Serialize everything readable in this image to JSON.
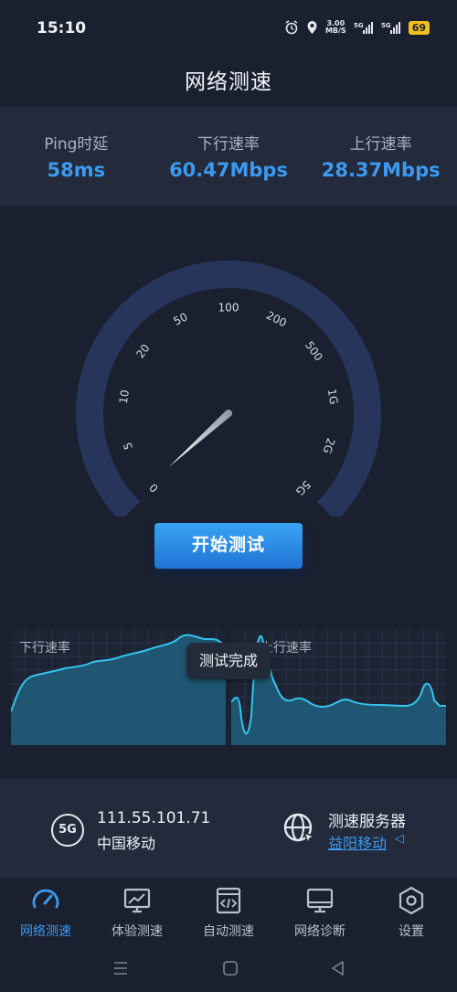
{
  "status_bar": {
    "time": "15:10",
    "net_speed": "3.00",
    "net_speed_unit": "MB/S",
    "signal1": "5G",
    "signal2": "5G",
    "battery": "69"
  },
  "page_title": "网络测速",
  "metrics": [
    {
      "label": "Ping时延",
      "value": "58ms"
    },
    {
      "label": "下行速率",
      "value": "60.47Mbps"
    },
    {
      "label": "上行速率",
      "value": "28.37Mbps"
    }
  ],
  "gauge": {
    "ticks": [
      "0",
      "5",
      "10",
      "20",
      "50",
      "100",
      "200",
      "500",
      "1G",
      "2G",
      "5G"
    ],
    "needle_value_mbps": 0
  },
  "start_button": "开始测试",
  "charts": {
    "download_title": "下行速率",
    "upload_title": "上行速率",
    "toast": "测试完成"
  },
  "network": {
    "badge": "5G",
    "ip": "111.55.101.71",
    "carrier": "中国移动"
  },
  "server": {
    "label": "测速服务器",
    "name": "益阳移动",
    "arrow": "◁"
  },
  "nav": [
    {
      "label": "网络测速",
      "icon": "speedometer-icon",
      "active": true
    },
    {
      "label": "体验测速",
      "icon": "chart-monitor-icon",
      "active": false
    },
    {
      "label": "自动测速",
      "icon": "code-window-icon",
      "active": false
    },
    {
      "label": "网络诊断",
      "icon": "monitor-icon",
      "active": false
    },
    {
      "label": "设置",
      "icon": "hexagon-settings-icon",
      "active": false
    }
  ],
  "colors": {
    "accent": "#3c9af0",
    "background": "#1a2030",
    "panel": "#222a3b",
    "gauge_arc": "#27355a"
  }
}
